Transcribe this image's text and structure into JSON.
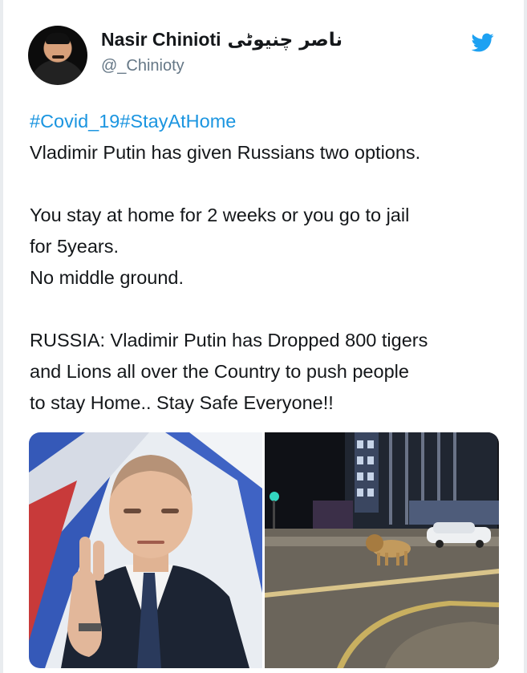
{
  "user": {
    "display_name": "Nasir Chinioti",
    "display_name_urdu": "ناصر چنیوٹی",
    "handle": "@_Chinioty",
    "avatar_icon": "profile-photo"
  },
  "brand": {
    "icon": "twitter-bird-icon",
    "color": "#1da1f2"
  },
  "tweet": {
    "hashtags": "#Covid_19#StayAtHome",
    "line1": "Vladimir Putin has given Russians two options.",
    "line2": "You stay at home for 2 weeks or you go to jail",
    "line3": "for 5years.",
    "line4": "No middle ground.",
    "line5": "RUSSIA: Vladimir Putin has Dropped 800 tigers",
    "line6": "and Lions all over the Country to push people",
    "line7": "to stay Home.. Stay Safe Everyone!!"
  },
  "media": [
    {
      "name": "photo-putin"
    },
    {
      "name": "photo-lion-street"
    }
  ],
  "colors": {
    "text": "#14171a",
    "secondary": "#657786",
    "link": "#1b95e0",
    "brand": "#1da1f2"
  }
}
